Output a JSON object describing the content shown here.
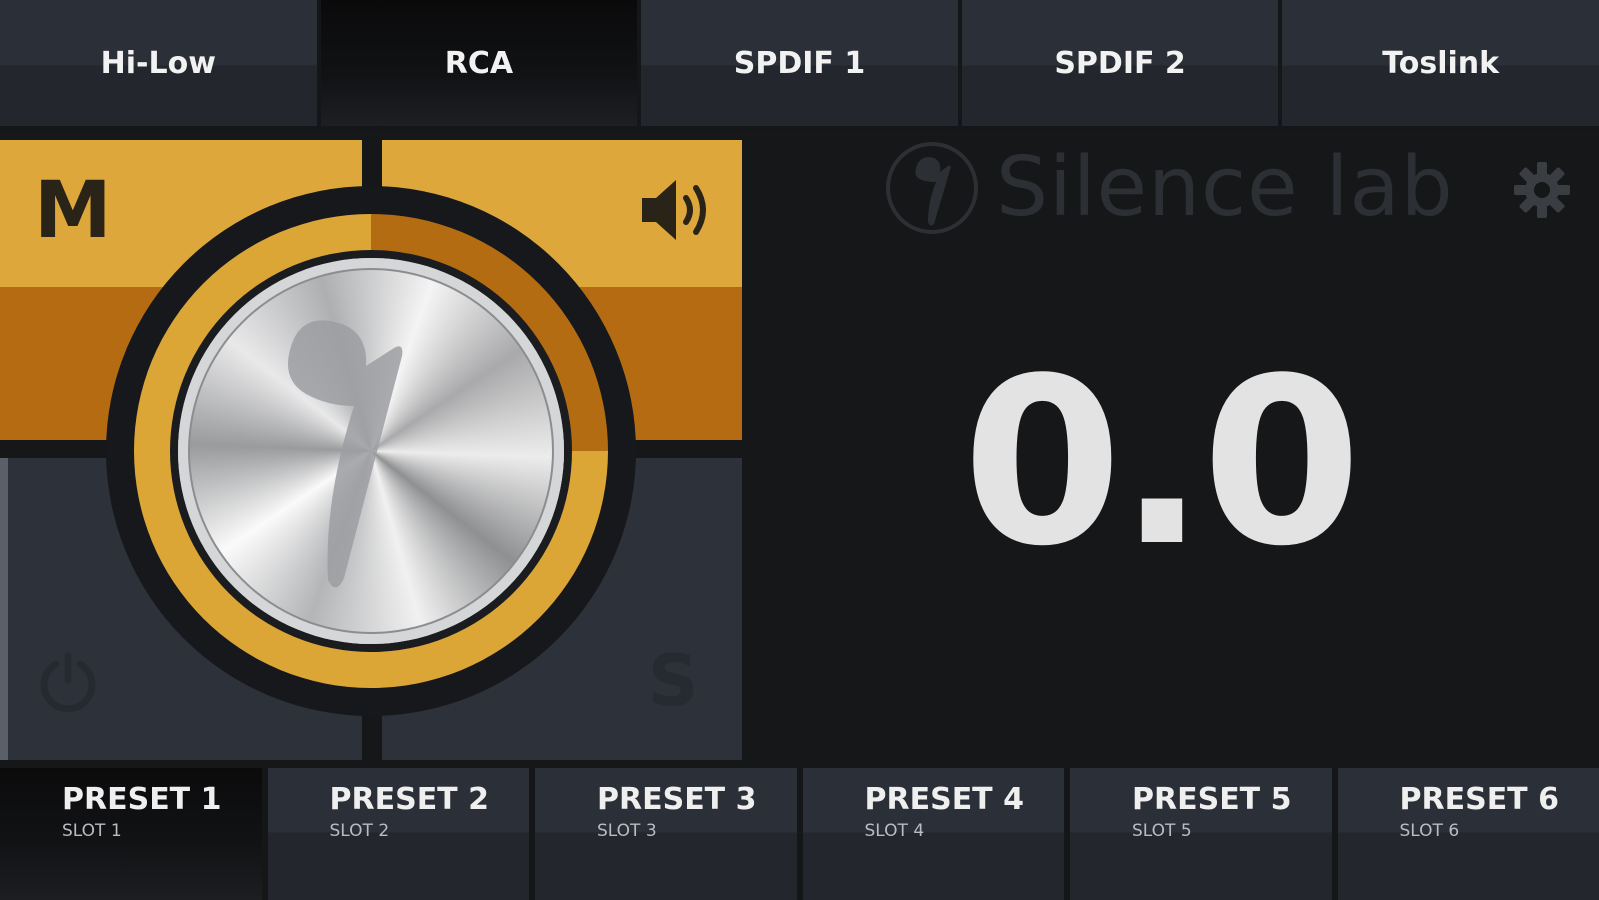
{
  "tabs": [
    {
      "label": "Hi-Low",
      "active": false
    },
    {
      "label": "RCA",
      "active": true
    },
    {
      "label": "SPDIF 1",
      "active": false
    },
    {
      "label": "SPDIF 2",
      "active": false
    },
    {
      "label": "Toslink",
      "active": false
    }
  ],
  "controls": {
    "mute_label": "M",
    "solo_label": "S",
    "speaker_icon": "speaker-icon",
    "power_icon": "power-icon",
    "knob_icon": "silence-lab-logo"
  },
  "brand": {
    "name": "Silence lab",
    "mark_icon": "silence-lab-mark"
  },
  "settings_icon": "gear-icon",
  "readout": {
    "value": "0.0"
  },
  "presets": [
    {
      "name": "PRESET 1",
      "slot": "SLOT 1",
      "active": true
    },
    {
      "name": "PRESET 2",
      "slot": "SLOT 2",
      "active": false
    },
    {
      "name": "PRESET 3",
      "slot": "SLOT 3",
      "active": false
    },
    {
      "name": "PRESET 4",
      "slot": "SLOT 4",
      "active": false
    },
    {
      "name": "PRESET 5",
      "slot": "SLOT 5",
      "active": false
    },
    {
      "name": "PRESET 6",
      "slot": "SLOT 6",
      "active": false
    }
  ],
  "colors": {
    "accent": "#dea73b",
    "accent_dark": "#b46b12",
    "panel": "#2b2f37",
    "background": "#161719"
  }
}
